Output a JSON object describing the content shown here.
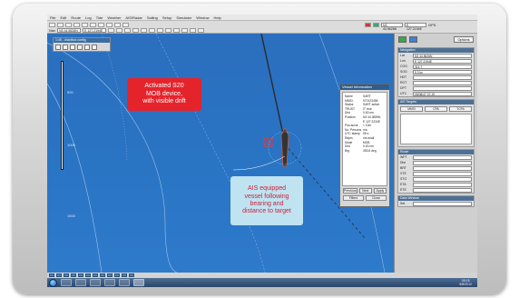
{
  "menu": [
    "File",
    "Edit",
    "Route",
    "Log",
    "Tide",
    "Weather",
    "AIS/Radar",
    "Sailing",
    "Setup",
    "Simulator",
    "Window",
    "Help"
  ],
  "toolbar": {
    "nav_label": "Nav",
    "nav_value": "N3 44.5626N",
    "nav_value2": "E 127.2194E",
    "pos_value": "N3 44.5626N",
    "pos_value2": "E 127.2194E",
    "mode": "GPS"
  },
  "mini_panel": {
    "title": "1:45 - chartbox config"
  },
  "depth_labels": [
    "500",
    "1000",
    "1500"
  ],
  "info_window": {
    "title": "Vessel Information",
    "rows": [
      {
        "k": "Name",
        "v": "SART"
      },
      {
        "k": "MMSI",
        "v": "970123456"
      },
      {
        "k": "Status",
        "v": "SART active"
      },
      {
        "k": "TRUST",
        "v": "0° true"
      },
      {
        "k": "Dist",
        "v": "0.63 nm"
      },
      {
        "k": "Position",
        "v": "N3 44.3659N"
      },
      {
        "k": "",
        "v": "E 127.2234E"
      },
      {
        "k": "Pos.accur",
        "v": "< 10m"
      },
      {
        "k": "No. Persons",
        "v": "n/a"
      },
      {
        "k": "UTC stamp",
        "v": "08 s"
      },
      {
        "k": "Rdprs",
        "v": "not avail"
      },
      {
        "k": "Mode",
        "v": "MOB"
      },
      {
        "k": "Dist",
        "v": "0.63 nm"
      },
      {
        "k": "Brg",
        "v": "353.8 deg"
      }
    ],
    "buttons": [
      "Previous",
      "Next",
      "Apply"
    ],
    "buttons2": [
      "Filters",
      "Close"
    ]
  },
  "callout_mob": [
    "Activated S20",
    "MOB device,",
    "with visible drift"
  ],
  "callout_ais": [
    "AIS equipped",
    "vessel following",
    "bearing and",
    "distance to target"
  ],
  "sidebar": {
    "options_label": "Options",
    "navigation": {
      "title": "Navigation",
      "rows": [
        {
          "lbl": "Lat",
          "val": "N3 44.5626N"
        },
        {
          "lbl": "Lon",
          "val": "E 127.2194E"
        },
        {
          "lbl": "COG",
          "val": "314.7"
        },
        {
          "lbl": "SOG",
          "val": "5.3 kn"
        },
        {
          "lbl": "HDT",
          "val": ""
        },
        {
          "lbl": "ROT",
          "val": ""
        },
        {
          "lbl": "DPT",
          "val": ""
        },
        {
          "lbl": "UTC",
          "val": "05/08/47 07:19"
        }
      ]
    },
    "ais_targets": {
      "title": "AIS Targets",
      "tabs": [
        "MMSI",
        "CPA",
        "TCPA"
      ]
    },
    "routing": {
      "title": "Route",
      "rows": [
        {
          "lbl": "WPT",
          "val": ""
        },
        {
          "lbl": "Dist",
          "val": ""
        },
        {
          "lbl": "BRT",
          "val": ""
        },
        {
          "lbl": "XTE",
          "val": ""
        },
        {
          "lbl": "STG",
          "val": ""
        },
        {
          "lbl": "ETA",
          "val": ""
        },
        {
          "lbl": "ETE",
          "val": ""
        }
      ]
    },
    "data_window": {
      "title": "Data Window",
      "rows": [
        {
          "lbl": "Set",
          "val": ""
        }
      ]
    }
  },
  "taskbar": {
    "time": "08:18",
    "date": "5/8/2012"
  },
  "colors": {
    "sea": "#2a74c4",
    "callout_red": "#e5232b",
    "callout_blue": "#bfe3f1",
    "callout_blue_text": "#c9243b",
    "target_track": "#d15a3a"
  }
}
